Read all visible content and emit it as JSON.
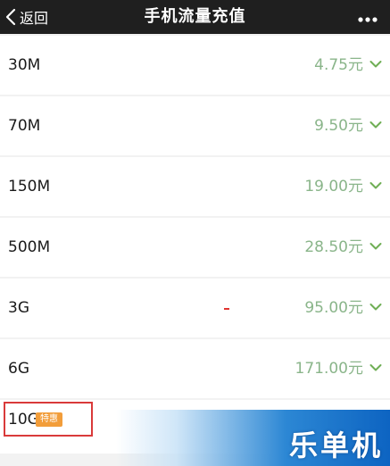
{
  "header": {
    "back_label": "返回",
    "title": "手机流量充值",
    "background": "#1f1f1f"
  },
  "packages": [
    {
      "name": "30M",
      "price": "4.75元"
    },
    {
      "name": "70M",
      "price": "9.50元"
    },
    {
      "name": "150M",
      "price": "19.00元"
    },
    {
      "name": "500M",
      "price": "28.50元"
    },
    {
      "name": "3G",
      "price": "95.00元"
    },
    {
      "name": "6G",
      "price": "171.00元"
    }
  ],
  "featured": {
    "name": "10G",
    "badge": "特惠"
  },
  "watermark": {
    "text": "乐单机"
  },
  "colors": {
    "price": "#8ab58a",
    "chevron": "#6fae55",
    "badge": "#f29d3a",
    "highlight": "#d93a3a"
  }
}
